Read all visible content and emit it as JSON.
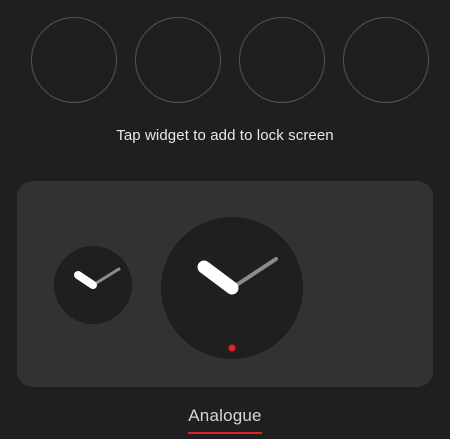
{
  "lock_screen_slots": {
    "count": 4
  },
  "hint_text": "Tap widget to add to lock screen",
  "widgets_panel": {
    "widgets": [
      {
        "kind": "analogue-clock-small"
      },
      {
        "kind": "analogue-clock-large",
        "indicator_color": "#e0242a"
      }
    ]
  },
  "category_tab": {
    "label": "Analogue",
    "underline_color": "#e0242a"
  },
  "colors": {
    "background": "#1f1f1f",
    "panel": "#323232",
    "clock_face": "#1f1f1f",
    "hour_hand": "#ffffff",
    "minute_hand": "#8c8c8c",
    "accent": "#e0242a"
  }
}
